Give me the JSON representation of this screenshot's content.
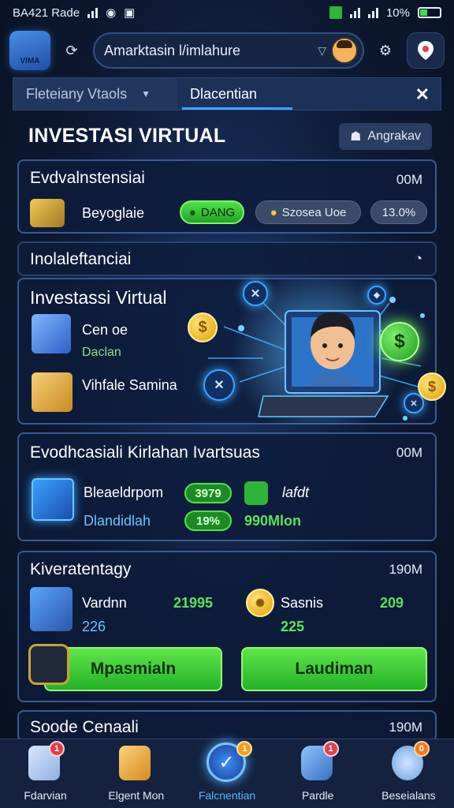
{
  "status_bar": {
    "left_text": "BA421 Rade",
    "battery": "10%"
  },
  "app_bar": {
    "logo_text": "VIMA",
    "search_text": "Amarktasin l/imlahure",
    "refresh_icon": "refresh-icon",
    "avatar_icon": "avatar-icon",
    "settings_icon": "gear-icon",
    "location_icon": "location-pin-icon"
  },
  "tabs": [
    {
      "label": "Fleteiany Vtaols"
    },
    {
      "label": "Dlacentian"
    }
  ],
  "header": {
    "title": "INVESTASI VIRTUAL",
    "action_label": "Angrakav"
  },
  "card1": {
    "title": "Evdvalnstensiai",
    "meta": "00M",
    "item_label": "Beyoglaie",
    "pill_green": "DANG",
    "pill_gray": "Szosea Uoe",
    "pill_percent": "13.0%"
  },
  "section_row": {
    "title": "Inolaleftanciai"
  },
  "card2": {
    "title": "Investassi Virtual",
    "item1_label": "Cen oe",
    "item1_sub": "Daclan",
    "item2_label": "Vihfale Samina"
  },
  "card3": {
    "title": "Evodhcasiali Kirlahan Ivartsuas",
    "meta": "00M",
    "row1_label": "Bleaeldrpom",
    "row1_value": "3979",
    "row1_right": "lafdt",
    "row2_label": "Dlandidlah",
    "row2_value": "19%",
    "row2_right": "990Mlon"
  },
  "card4": {
    "title": "Kiveratentagy",
    "meta": "190M",
    "left_label": "Vardnn",
    "left_value": "21995",
    "left_sub": "226",
    "right_label": "Sasnis",
    "right_value": "209",
    "right_sub": "225",
    "btn_left": "Mpasmialn",
    "btn_right": "Laudiman"
  },
  "card5": {
    "title": "Soode Cenaali",
    "meta": "190M"
  },
  "bottom_nav": [
    {
      "label": "Fdarvian",
      "badge": "1",
      "icon": "home-icon"
    },
    {
      "label": "Elgent Mon",
      "badge": "",
      "icon": "box-icon"
    },
    {
      "label": "Falcnentian",
      "badge": "1",
      "icon": "check-circle-icon"
    },
    {
      "label": "Pardle",
      "badge": "1",
      "icon": "cup-icon"
    },
    {
      "label": "Beseialans",
      "badge": "0",
      "icon": "chat-icon"
    }
  ]
}
